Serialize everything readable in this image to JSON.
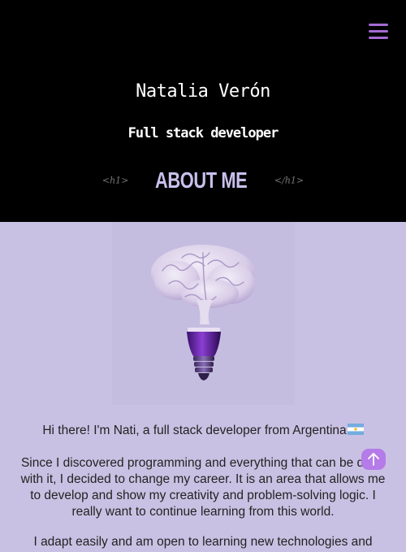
{
  "header": {
    "name": "Natalia Verón",
    "role": "Full stack developer",
    "section_tag_open": "<h1>",
    "section_title": "ABOUT ME",
    "section_tag_close": "</h1>"
  },
  "about": {
    "intro": "Hi there! I'm Nati, a full stack developer from Argentina",
    "paragraph_2": "Since I discovered programming and everything that can be done with it, I decided to change my career. It is an area that allows me to develop and show my creativity and problem-solving logic. I really want to continue learning from this world.",
    "paragraph_3": "I adapt easily and am open to learning new technologies and"
  },
  "icons": {
    "menu": "hamburger-menu-icon",
    "scroll_top": "arrow-up-icon",
    "flag": "argentina-flag-icon",
    "image": "brain-lightbulb-illustration"
  },
  "colors": {
    "header_bg": "#000000",
    "page_bg": "#c9c1e3",
    "accent": "#a46ad4",
    "title": "#c9c0ec"
  }
}
